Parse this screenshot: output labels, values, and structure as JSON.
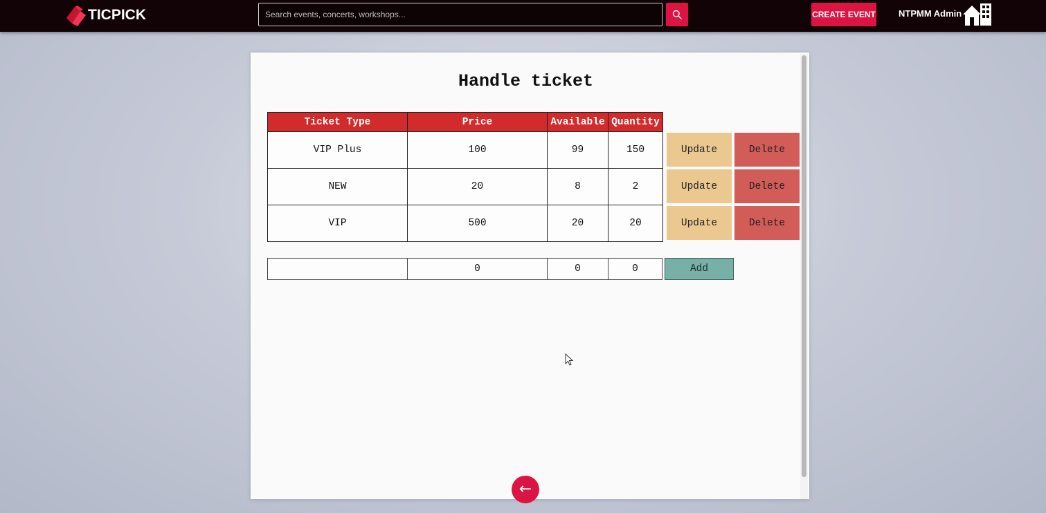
{
  "header": {
    "logo_text": "TICPICK",
    "search_placeholder": "Search events, concerts, workshops...",
    "search_icon": "search-icon",
    "create_event_label": "CREATE EVENT",
    "user_name": "NTPMM Admin",
    "home_icon": "home-icon"
  },
  "page": {
    "title": "Handle ticket"
  },
  "table": {
    "headers": [
      "Ticket Type",
      "Price",
      "Available",
      "Quantity"
    ],
    "rows": [
      {
        "type": "VIP Plus",
        "price": "100",
        "available": "99",
        "quantity": "150"
      },
      {
        "type": "NEW",
        "price": "20",
        "available": "8",
        "quantity": "2"
      },
      {
        "type": "VIP",
        "price": "500",
        "available": "20",
        "quantity": "20"
      }
    ],
    "update_label": "Update",
    "delete_label": "Delete"
  },
  "add_form": {
    "type_value": "",
    "price_value": "0",
    "available_value": "0",
    "quantity_value": "0",
    "add_label": "Add"
  },
  "back_button": {
    "label": "←"
  },
  "colors": {
    "brand": "#dc1443",
    "header_red": "#d12b2b",
    "update": "#ebc890",
    "delete": "#d15c58",
    "add": "#78b0a8",
    "topbar": "#120306"
  }
}
